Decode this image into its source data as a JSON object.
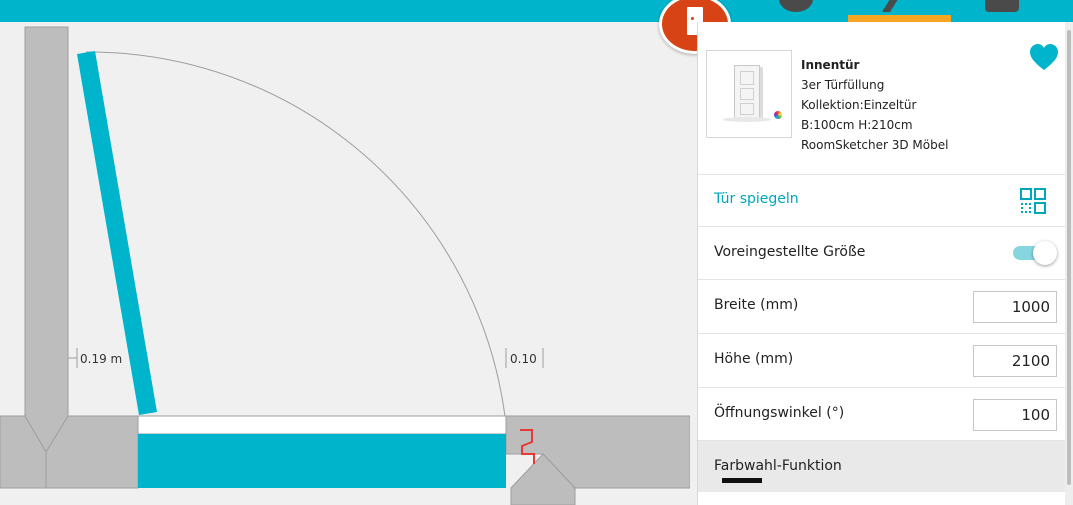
{
  "toolbar": {
    "tabs": [
      {
        "icon": "circle-tool-icon"
      },
      {
        "icon": "pencil-tool-icon",
        "active": true
      },
      {
        "icon": "camera-tool-icon"
      }
    ],
    "active_color": "#f5a623",
    "bar_color": "#00b4cc"
  },
  "selected_object_badge": {
    "icon": "door-icon",
    "color": "#d84315"
  },
  "canvas": {
    "dimension_left": "0.19 m",
    "dimension_right": "0.10",
    "door_color": "#00b4cc",
    "wall_color": "#bdbdbd",
    "marker_color": "#e53935"
  },
  "product": {
    "title": "Innentür",
    "line1": "3er Türfüllung",
    "line2": "Kollektion:Einzeltür",
    "line3": "B:100cm H:210cm",
    "line4": "RoomSketcher 3D Möbel",
    "favorite_icon": "heart-icon"
  },
  "properties": {
    "mirror_label": "Tür spiegeln",
    "preset_size_label": "Voreingestellte Größe",
    "preset_size_on": true,
    "width_label": "Breite (mm)",
    "width_value": "1000",
    "height_label": "Höhe (mm)",
    "height_value": "2100",
    "angle_label": "Öffnungswinkel (°)",
    "angle_value": "100",
    "color_label": "Farbwahl-Funktion"
  },
  "accent_color": "#00a6bd"
}
